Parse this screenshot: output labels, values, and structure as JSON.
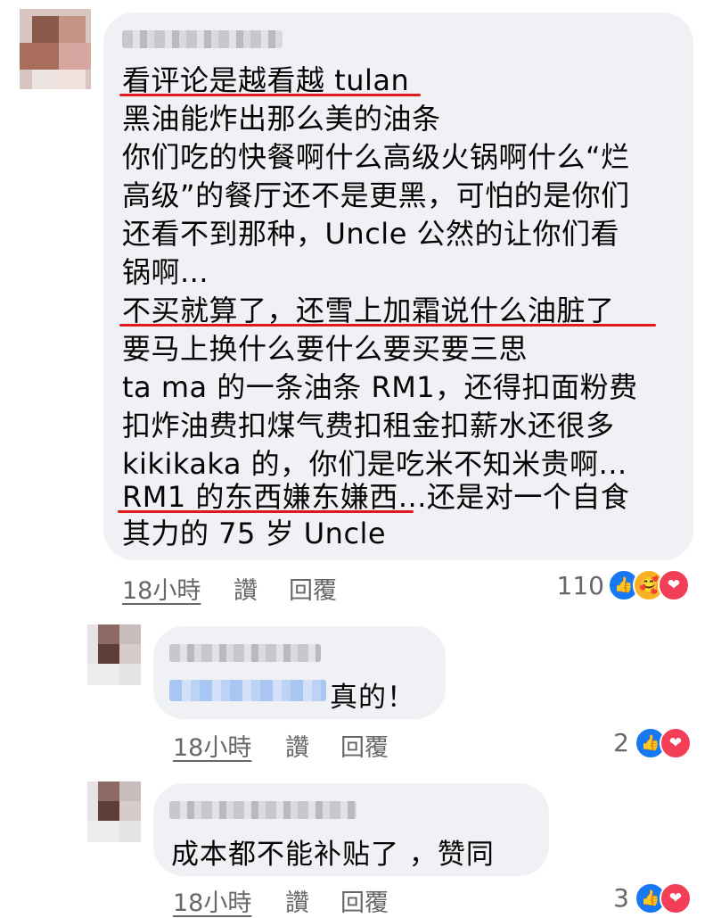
{
  "main_comment": {
    "lines": [
      "看评论是越看越 tulan",
      "黑油能炸出那么美的油条",
      "你们吃的快餐啊什么高级火锅啊什么“烂",
      "高级”的餐厅还不是更黑，可怕的是你们",
      "还看不到那种，Uncle 公然的让你们看",
      "锅啊...",
      "不买就算了，还雪上加霜说什么油脏了",
      "要马上换什么要什么要买要三思",
      "ta ma 的一条油条 RM1，还得扣面粉费",
      "扣炸油费扣煤气费扣租金扣薪水还很多",
      "kikikaka 的，你们是吃米不知米贵啊...",
      "RM1 的东西嫌东嫌西...还是对一个自食",
      "其力的 75 岁 Uncle"
    ],
    "time": "18小時",
    "like_label": "讚",
    "reply_label": "回覆",
    "reaction_count": "110"
  },
  "replies": [
    {
      "text": "真的！",
      "time": "18小時",
      "like_label": "讚",
      "reply_label": "回覆",
      "reaction_count": "2"
    },
    {
      "text": "成本都不能补贴了 ，赞同",
      "time": "18小時",
      "like_label": "讚",
      "reply_label": "回覆",
      "reaction_count": "3"
    }
  ],
  "icons": {
    "like": "like-icon",
    "care": "care-icon",
    "love": "love-icon"
  },
  "colors": {
    "underline": "#e0191c",
    "like": "#1877f2",
    "love": "#f33e58",
    "care": "#f7b125",
    "bubble": "#eff1f4"
  }
}
